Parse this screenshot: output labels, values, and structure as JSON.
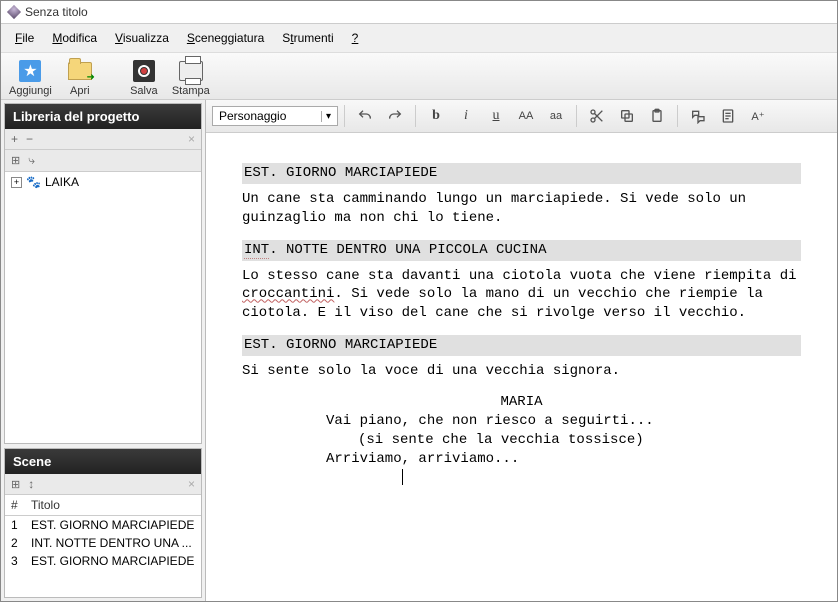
{
  "window": {
    "title": "Senza titolo"
  },
  "menu": {
    "file": "File",
    "modifica": "Modifica",
    "visualizza": "Visualizza",
    "sceneggiatura": "Sceneggiatura",
    "strumenti": "Strumenti",
    "help": "?"
  },
  "toolbar": {
    "aggiungi": "Aggiungi",
    "apri": "Apri",
    "salva": "Salva",
    "stampa": "Stampa"
  },
  "left": {
    "library_title": "Libreria del progetto",
    "goto": "⤷",
    "project_root": "LAIKA",
    "scene_title": "Scene",
    "scene_cols": {
      "num": "#",
      "titolo": "Titolo"
    },
    "scenes": [
      {
        "n": "1",
        "t": "EST. GIORNO MARCIAPIEDE"
      },
      {
        "n": "2",
        "t": "INT. NOTTE DENTRO UNA ..."
      },
      {
        "n": "3",
        "t": "EST. GIORNO MARCIAPIEDE"
      }
    ]
  },
  "formatbar": {
    "style": "Personaggio",
    "undo": "↶",
    "redo": "↷",
    "bold": "b",
    "italic": "i",
    "underline": "u",
    "caps": "AA",
    "lower": "aa",
    "aplus": "A⁺"
  },
  "script": {
    "sh1": "EST. GIORNO MARCIAPIEDE",
    "a1": "Un cane sta camminando lungo un marciapiede. Si vede solo un guinzaglio ma non chi lo tiene.",
    "sh2_a": "INT",
    "sh2_b": ". NOTTE DENTRO UNA PICCOLA CUCINA",
    "a2_a": "Lo stesso cane sta davanti una ciotola vuota che viene riempita di ",
    "a2_b": "croccantini",
    "a2_c": ". Si vede solo la mano di un vecchio che riempie la ciotola. E il viso del cane che si rivolge verso il vecchio.",
    "sh3": "EST. GIORNO MARCIAPIEDE",
    "a3": "Si sente solo la voce di una vecchia signora.",
    "char1": "MARIA",
    "d1": "Vai piano, che non riesco a seguirti...",
    "p1": "(si sente che la vecchia tossisce)",
    "d2": "Arriviamo, arriviamo..."
  }
}
